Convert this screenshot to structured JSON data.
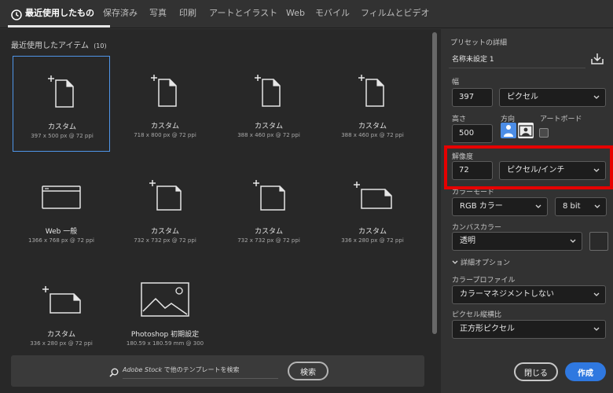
{
  "tabs": [
    {
      "label": "最近使用したもの"
    },
    {
      "label": "保存済み"
    },
    {
      "label": "写真"
    },
    {
      "label": "印刷"
    },
    {
      "label": "アートとイラスト"
    },
    {
      "label": "Web"
    },
    {
      "label": "モバイル"
    },
    {
      "label": "フィルムとビデオ"
    }
  ],
  "recent": {
    "title": "最近使用したアイテム",
    "count": "(10)",
    "items": [
      {
        "name": "カスタム",
        "size": "397 x 500 px @ 72 ppi",
        "icon": "custom-document-icon"
      },
      {
        "name": "カスタム",
        "size": "718 x 800 px @ 72 ppi",
        "icon": "custom-document-icon"
      },
      {
        "name": "カスタム",
        "size": "388 x 460 px @ 72 ppi",
        "icon": "custom-document-icon"
      },
      {
        "name": "カスタム",
        "size": "388 x 460 px @ 72 ppi",
        "icon": "custom-document-icon"
      },
      {
        "name": "Web 一般",
        "size": "1366 x 768 px @ 72 ppi",
        "icon": "web-browser-icon"
      },
      {
        "name": "カスタム",
        "size": "732 x 732 px @ 72 ppi",
        "icon": "custom-document-icon"
      },
      {
        "name": "カスタム",
        "size": "732 x 732 px @ 72 ppi",
        "icon": "custom-document-icon"
      },
      {
        "name": "カスタム",
        "size": "336 x 280 px @ 72 ppi",
        "icon": "custom-landscape-icon"
      },
      {
        "name": "カスタム",
        "size": "336 x 280 px @ 72 ppi",
        "icon": "custom-landscape-icon"
      },
      {
        "name": "Photoshop 初期設定",
        "size": "180.59 x 180.59 mm @ 300",
        "icon": "photo-image-icon"
      }
    ]
  },
  "search": {
    "placeholder_italic": "Adobe Stock",
    "placeholder_rest": " で他のテンプレートを検索",
    "button": "検索"
  },
  "preset": {
    "section_label": "プリセットの詳細",
    "name": "名称未設定 1",
    "width_label": "幅",
    "width_value": "397",
    "width_unit": "ピクセル",
    "height_label": "高さ",
    "height_value": "500",
    "orientation_label": "方向",
    "artboard_label": "アートボード",
    "resolution_label": "解像度",
    "resolution_value": "72",
    "resolution_unit": "ピクセル/インチ",
    "color_mode_label": "カラーモード",
    "color_mode": "RGB カラー",
    "bit_depth": "8 bit",
    "canvas_color_label": "カンバスカラー",
    "canvas_color": "透明",
    "advanced_label": "詳細オプション",
    "color_profile_label": "カラープロファイル",
    "color_profile": "カラーマネジメントしない",
    "pixel_aspect_label": "ピクセル縦横比",
    "pixel_aspect": "正方形ピクセル"
  },
  "buttons": {
    "close": "閉じる",
    "create": "作成"
  },
  "colors": {
    "accent": "#2f78e0",
    "highlight": "#e60000"
  }
}
